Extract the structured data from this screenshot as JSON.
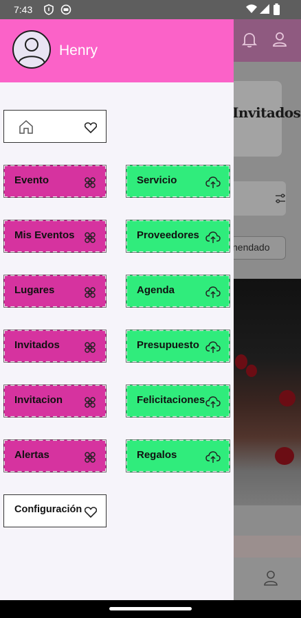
{
  "status_bar": {
    "time": "7:43"
  },
  "background_app": {
    "banner_text": "Invitados",
    "chip_text": "nendado"
  },
  "drawer": {
    "user_name": "Henry",
    "home": {
      "label": ""
    },
    "left_column": [
      {
        "label": "Evento",
        "icon": "flower-icon"
      },
      {
        "label": "Mis Eventos",
        "icon": "flower-icon"
      },
      {
        "label": "Lugares",
        "icon": "flower-icon"
      },
      {
        "label": "Invitados",
        "icon": "flower-icon"
      },
      {
        "label": "Invitacion",
        "icon": "flower-icon"
      },
      {
        "label": "Alertas",
        "icon": "flower-icon"
      }
    ],
    "right_column": [
      {
        "label": "Servicio",
        "icon": "cloud-upload-icon"
      },
      {
        "label": "Proveedores",
        "icon": "cloud-upload-icon"
      },
      {
        "label": "Agenda",
        "icon": "cloud-upload-icon"
      },
      {
        "label": "Presupuesto",
        "icon": "cloud-upload-icon"
      },
      {
        "label": "Felicitaciones",
        "icon": "cloud-upload-icon"
      },
      {
        "label": "Regalos",
        "icon": "cloud-upload-icon"
      }
    ],
    "settings": {
      "label": "Configuración",
      "icon": "heart-icon"
    }
  },
  "colors": {
    "drawer_header": "#fb62c8",
    "pink_tile": "#d6339f",
    "green_tile": "#30ec7c",
    "drawer_bg": "#f6f4fa"
  }
}
